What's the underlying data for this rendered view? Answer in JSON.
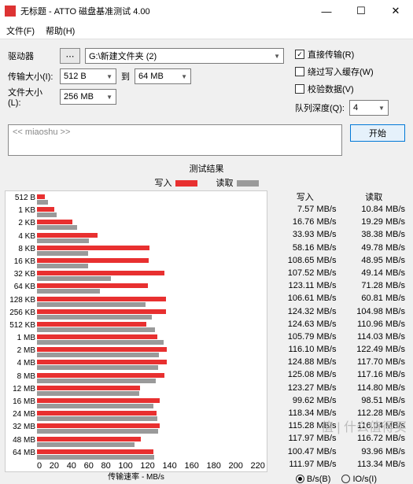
{
  "window": {
    "title": "无标题 - ATTO 磁盘基准测试 4.00"
  },
  "menu": {
    "file": "文件(F)",
    "help": "帮助(H)"
  },
  "form": {
    "drive_lbl": "驱动器",
    "drive_val": "G:\\新建文件夹 (2)",
    "ts_lbl": "传输大小(I):",
    "ts_from": "512 B",
    "ts_to_lbl": "到",
    "ts_to": "64 MB",
    "fs_lbl": "文件大小(L):",
    "fs_val": "256 MB",
    "direct": "直接传输(R)",
    "bypass": "绕过写入缓存(W)",
    "verify": "校验数据(V)",
    "qd_lbl": "队列深度(Q):",
    "qd_val": "4",
    "desc": "<< miaoshu >>",
    "start": "开始"
  },
  "results": {
    "title": "测试结果",
    "write": "写入",
    "read": "读取",
    "xlabel": "传输速率 - MB/s"
  },
  "radios": {
    "bs": "B/s(B)",
    "ios": "IO/s(I)"
  },
  "chart_data": {
    "type": "bar",
    "xlim": [
      0,
      220
    ],
    "xticks": [
      0,
      20,
      40,
      60,
      80,
      100,
      120,
      140,
      160,
      180,
      200,
      220
    ],
    "series": [
      {
        "name": "写入"
      },
      {
        "name": "读取"
      }
    ],
    "rows": [
      {
        "label": "512 B",
        "w": 7.57,
        "r": 10.84
      },
      {
        "label": "1 KB",
        "w": 16.76,
        "r": 19.29
      },
      {
        "label": "2 KB",
        "w": 33.93,
        "r": 38.38
      },
      {
        "label": "4 KB",
        "w": 58.16,
        "r": 49.78
      },
      {
        "label": "8 KB",
        "w": 108.65,
        "r": 48.95
      },
      {
        "label": "16 KB",
        "w": 107.52,
        "r": 49.14
      },
      {
        "label": "32 KB",
        "w": 123.11,
        "r": 71.28
      },
      {
        "label": "64 KB",
        "w": 106.61,
        "r": 60.81
      },
      {
        "label": "128 KB",
        "w": 124.32,
        "r": 104.98
      },
      {
        "label": "256 KB",
        "w": 124.63,
        "r": 110.96
      },
      {
        "label": "512 KB",
        "w": 105.79,
        "r": 114.03
      },
      {
        "label": "1 MB",
        "w": 116.1,
        "r": 122.49
      },
      {
        "label": "2 MB",
        "w": 124.88,
        "r": 117.7
      },
      {
        "label": "4 MB",
        "w": 125.08,
        "r": 117.16
      },
      {
        "label": "8 MB",
        "w": 123.27,
        "r": 114.8
      },
      {
        "label": "12 MB",
        "w": 99.62,
        "r": 98.51
      },
      {
        "label": "16 MB",
        "w": 118.34,
        "r": 112.28
      },
      {
        "label": "24 MB",
        "w": 115.28,
        "r": 116.04
      },
      {
        "label": "32 MB",
        "w": 117.97,
        "r": 116.72
      },
      {
        "label": "48 MB",
        "w": 100.47,
        "r": 93.96
      },
      {
        "label": "64 MB",
        "w": 111.97,
        "r": 113.34
      }
    ]
  },
  "watermark": "值 | 什么值得买"
}
